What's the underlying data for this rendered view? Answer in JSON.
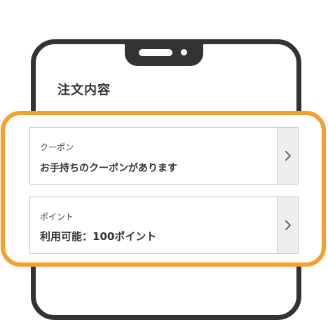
{
  "screen": {
    "title": "注文内容"
  },
  "coupon": {
    "label": "クーポン",
    "value": "お手持ちのクーポンがあります",
    "chevron_icon": "chevron-right-icon"
  },
  "points": {
    "label": "ポイント",
    "value": "利用可能：100ポイント",
    "chevron_icon": "chevron-right-icon"
  },
  "colors": {
    "highlight": "#F5A02C",
    "frame": "#333333",
    "chevron_bg": "#eeeeee"
  }
}
